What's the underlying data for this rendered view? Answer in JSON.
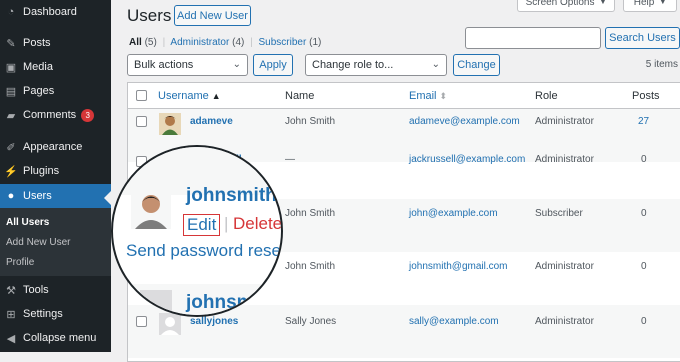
{
  "sidebar": {
    "items": [
      {
        "label": "Dashboard",
        "icon": "dashboard-icon"
      },
      {
        "label": "Posts",
        "icon": "pin-icon"
      },
      {
        "label": "Media",
        "icon": "media-icon"
      },
      {
        "label": "Pages",
        "icon": "pages-icon"
      },
      {
        "label": "Comments",
        "icon": "comments-icon",
        "badge": "3"
      },
      {
        "label": "Appearance",
        "icon": "brush-icon"
      },
      {
        "label": "Plugins",
        "icon": "plugin-icon"
      },
      {
        "label": "Users",
        "icon": "users-icon"
      },
      {
        "label": "Tools",
        "icon": "wrench-icon"
      },
      {
        "label": "Settings",
        "icon": "settings-icon"
      },
      {
        "label": "Collapse menu",
        "icon": "collapse-icon"
      }
    ],
    "submenu": [
      "All Users",
      "Add New User",
      "Profile"
    ],
    "active_color": "#2271b1"
  },
  "header": {
    "title": "Users",
    "add_new": "Add New User",
    "screen_options": "Screen Options",
    "help": "Help"
  },
  "views": {
    "all": "All",
    "all_count": "(5)",
    "administrator": "Administrator",
    "administrator_count": "(4)",
    "subscriber": "Subscriber",
    "subscriber_count": "(1)"
  },
  "search": {
    "button": "Search Users",
    "value": ""
  },
  "actions": {
    "bulk": "Bulk actions",
    "apply": "Apply",
    "role": "Change role to...",
    "change": "Change",
    "count": "5 items"
  },
  "table": {
    "headers": [
      "Username",
      "Name",
      "Email",
      "Role",
      "Posts"
    ],
    "rows": [
      {
        "username": "adameve",
        "name": "John Smith",
        "email": "adameve@example.com",
        "role": "Administrator",
        "posts": "27"
      },
      {
        "username": "jackrussell",
        "name": "—",
        "email": "jackrussell@example.com",
        "role": "Administrator",
        "posts": "0"
      },
      {
        "username": "johnsmith",
        "name": "John Smith",
        "email": "john@example.com",
        "role": "Subscriber",
        "posts": "0"
      },
      {
        "username": "johnsmith",
        "name": "John Smith",
        "email": "johnsmith@gmail.com",
        "role": "Administrator",
        "posts": "0"
      },
      {
        "username": "sallyjones",
        "name": "Sally Jones",
        "email": "sally@example.com",
        "role": "Administrator",
        "posts": "0"
      }
    ]
  },
  "zoom": {
    "username": "johnsmith",
    "edit": "Edit",
    "pipe": "|",
    "delete": "Delete",
    "send_reset": "Send password reset",
    "next_username": "johnsmith"
  }
}
